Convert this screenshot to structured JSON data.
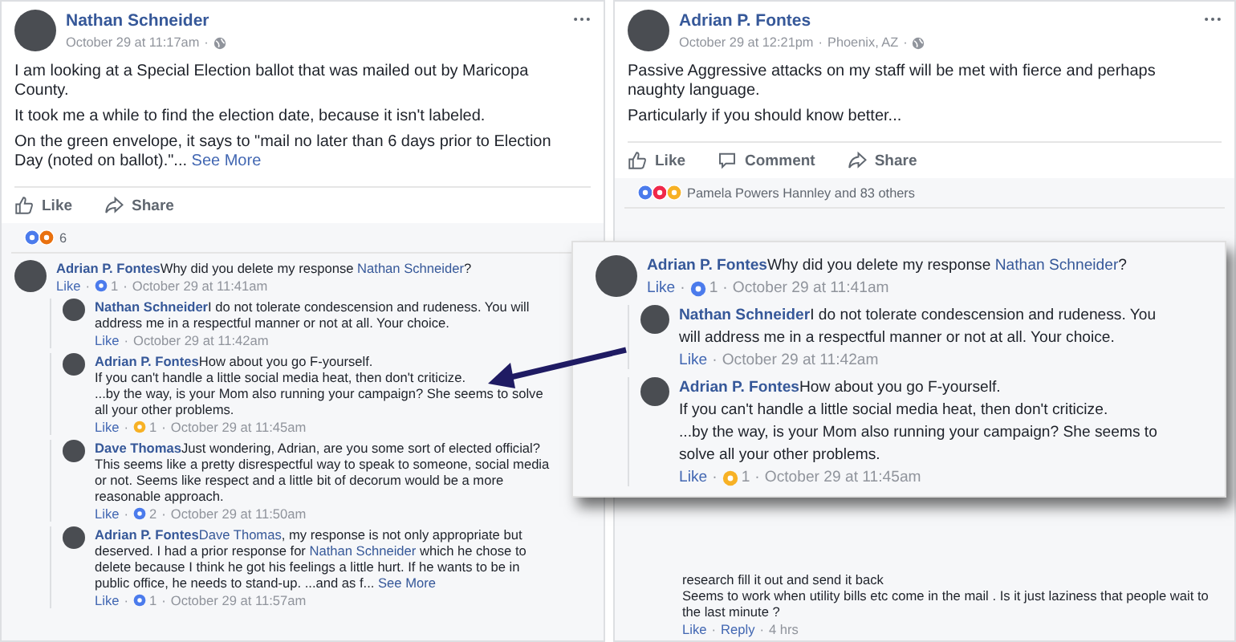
{
  "left_post": {
    "author": "Nathan Schneider",
    "meta": [
      "October 29 at 11:17am",
      "·"
    ],
    "paragraphs": [
      [
        {
          "kind": "plain",
          "text": "I am looking at a Special Election ballot that was mailed out by Maricopa County."
        }
      ],
      [
        {
          "kind": "plain",
          "text": "It took me a while to find the election date, because it isn't labeled."
        }
      ],
      [
        {
          "kind": "plain",
          "text": "On the green envelope, it says to \"mail no later than 6 days prior to Election Day (noted on ballot).\"..."
        },
        {
          "kind": "link",
          "text": " See More"
        }
      ]
    ],
    "actions": [
      {
        "kind": "like",
        "label": "Like"
      },
      {
        "kind": "share",
        "label": "Share"
      }
    ],
    "reactions": {
      "icons": [
        {
          "kind": "like"
        },
        {
          "kind": "angry"
        }
      ],
      "text": "6"
    },
    "comments": [
      {
        "author": "Adrian P. Fontes",
        "paragraphs": [
          [
            {
              "kind": "plain",
              "text": "Why did you delete my response "
            },
            {
              "kind": "mention",
              "text": "Nathan Schneider"
            },
            {
              "kind": "plain",
              "text": "?"
            }
          ]
        ],
        "footer": [
          {
            "kind": "link",
            "text": "Like"
          },
          {
            "kind": "sep",
            "text": "·"
          },
          {
            "kind": "like",
            "text": "1"
          },
          {
            "kind": "sep",
            "text": "·"
          },
          {
            "kind": "time",
            "text": "October 29 at 11:41am"
          }
        ],
        "children": [
          {
            "author": "Nathan Schneider",
            "paragraphs": [
              [
                {
                  "kind": "plain",
                  "text": "I do not tolerate condescension and rudeness. You will address me in a respectful manner or not at all. Your choice."
                }
              ]
            ],
            "footer": [
              {
                "kind": "link",
                "text": "Like"
              },
              {
                "kind": "sep",
                "text": "·"
              },
              {
                "kind": "time",
                "text": "October 29 at 11:42am"
              }
            ]
          },
          {
            "author": "Adrian P. Fontes",
            "paragraphs": [
              [
                {
                  "kind": "plain",
                  "text": "How about you go F-yourself."
                }
              ],
              [
                {
                  "kind": "plain",
                  "text": "If you can't handle a little social media heat, then don't criticize."
                }
              ],
              [
                {
                  "kind": "plain",
                  "text": "...by the way, is your Mom also running your campaign? She seems to solve all your other problems."
                }
              ]
            ],
            "footer": [
              {
                "kind": "link",
                "text": "Like"
              },
              {
                "kind": "sep",
                "text": "·"
              },
              {
                "kind": "haha",
                "text": "1"
              },
              {
                "kind": "sep",
                "text": "·"
              },
              {
                "kind": "time",
                "text": "October 29 at 11:45am"
              }
            ]
          },
          {
            "author": "Dave Thomas",
            "paragraphs": [
              [
                {
                  "kind": "plain",
                  "text": "Just wondering, Adrian, are you some sort of elected official? This seems like a pretty disrespectful way to speak to someone, social media or not. Seems like respect and a little bit of decorum would be a more reasonable approach."
                }
              ]
            ],
            "footer": [
              {
                "kind": "link",
                "text": "Like"
              },
              {
                "kind": "sep",
                "text": "·"
              },
              {
                "kind": "like",
                "text": "2"
              },
              {
                "kind": "sep",
                "text": "·"
              },
              {
                "kind": "time",
                "text": "October 29 at 11:50am"
              }
            ]
          },
          {
            "author": "Adrian P. Fontes",
            "paragraphs": [
              [
                {
                  "kind": "mention",
                  "text": "Dave Thomas"
                },
                {
                  "kind": "plain",
                  "text": ", my response is not only appropriate but deserved. I had a prior response for "
                },
                {
                  "kind": "mention",
                  "text": "Nathan Schneider"
                },
                {
                  "kind": "plain",
                  "text": " which he chose to delete because I think he got his feelings a little hurt. If he wants to be in public office, he needs to stand-up. ...and as f..."
                },
                {
                  "kind": "link",
                  "text": " See More"
                }
              ]
            ],
            "footer": [
              {
                "kind": "link",
                "text": "Like"
              },
              {
                "kind": "sep",
                "text": "·"
              },
              {
                "kind": "like",
                "text": "1"
              },
              {
                "kind": "sep",
                "text": "·"
              },
              {
                "kind": "time",
                "text": "October 29 at 11:57am"
              }
            ]
          }
        ]
      }
    ]
  },
  "right_post": {
    "author": "Adrian P. Fontes",
    "meta": [
      "October 29 at 12:21pm",
      "·",
      "Phoenix, AZ",
      "·"
    ],
    "paragraphs": [
      [
        {
          "kind": "plain",
          "text": "Passive Aggressive attacks on my staff will be met with fierce and perhaps naughty language."
        }
      ],
      [
        {
          "kind": "plain",
          "text": "Particularly if you should know better..."
        }
      ]
    ],
    "actions": [
      {
        "kind": "like",
        "label": "Like"
      },
      {
        "kind": "comment",
        "label": "Comment"
      },
      {
        "kind": "share",
        "label": "Share"
      }
    ],
    "reactions": {
      "icons": [
        {
          "kind": "like"
        },
        {
          "kind": "love"
        },
        {
          "kind": "wow"
        }
      ],
      "text": "Pamela Powers Hannley and 83 others"
    },
    "partial_comment": {
      "lines": [
        "research fill it out and send it back",
        "Seems to work when utility bills etc come in the mail . Is it just laziness that people wait to the last minute ?"
      ],
      "footer": [
        {
          "kind": "link",
          "text": "Like"
        },
        {
          "kind": "sep",
          "text": "·"
        },
        {
          "kind": "link",
          "text": "Reply"
        },
        {
          "kind": "sep",
          "text": "·"
        },
        {
          "kind": "time",
          "text": "4 hrs"
        }
      ]
    }
  },
  "zoomed_excerpt": {
    "comments": [
      {
        "author": "Adrian P. Fontes",
        "paragraphs": [
          [
            {
              "kind": "plain",
              "text": "Why did you delete my response "
            },
            {
              "kind": "mention",
              "text": "Nathan Schneider"
            },
            {
              "kind": "plain",
              "text": "?"
            }
          ]
        ],
        "footer": [
          {
            "kind": "link",
            "text": "Like"
          },
          {
            "kind": "sep",
            "text": "·"
          },
          {
            "kind": "like",
            "text": "1"
          },
          {
            "kind": "sep",
            "text": "·"
          },
          {
            "kind": "time",
            "text": "October 29 at 11:41am"
          }
        ],
        "children": [
          {
            "author": "Nathan Schneider",
            "paragraphs": [
              [
                {
                  "kind": "plain",
                  "text": "I do not tolerate condescension and rudeness. You will address me in a respectful manner or not at all. Your choice."
                }
              ]
            ],
            "footer": [
              {
                "kind": "link",
                "text": "Like"
              },
              {
                "kind": "sep",
                "text": "·"
              },
              {
                "kind": "time",
                "text": "October 29 at 11:42am"
              }
            ]
          },
          {
            "author": "Adrian P. Fontes",
            "paragraphs": [
              [
                {
                  "kind": "plain",
                  "text": "How about you go F-yourself."
                }
              ],
              [
                {
                  "kind": "plain",
                  "text": "If you can't handle a little social media heat, then don't criticize."
                }
              ],
              [
                {
                  "kind": "plain",
                  "text": "...by the way, is your Mom also running your campaign? She seems to solve all your other problems."
                }
              ]
            ],
            "footer": [
              {
                "kind": "link",
                "text": "Like"
              },
              {
                "kind": "sep",
                "text": "·"
              },
              {
                "kind": "haha",
                "text": "1"
              },
              {
                "kind": "sep",
                "text": "·"
              },
              {
                "kind": "time",
                "text": "October 29 at 11:45am"
              }
            ]
          }
        ]
      }
    ]
  }
}
